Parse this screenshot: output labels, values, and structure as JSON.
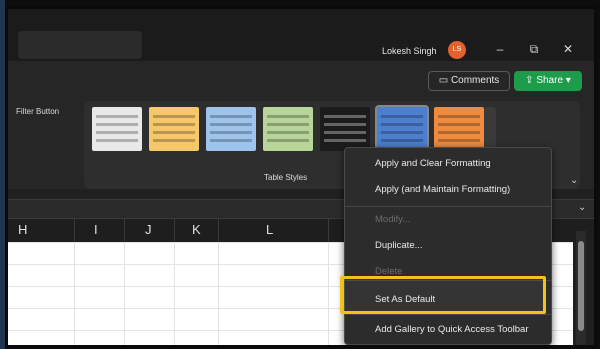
{
  "titlebar": {
    "user_name": "Lokesh Singh",
    "avatar_initials": "LS",
    "minimize": "–",
    "restore": "⧉",
    "close": "✕"
  },
  "ribbon": {
    "comments_label": "Comments",
    "share_label": "Share",
    "filter_button_label": "Filter Button",
    "table_styles_label": "Table Styles",
    "swatch_colors": [
      "#e8e8e8",
      "#f6c86a",
      "#9ec4ee",
      "#b8d69a",
      "#1c1c1c",
      "#4c7fd0",
      "#f08a3c"
    ]
  },
  "columns": [
    "H",
    "I",
    "J",
    "K",
    "L"
  ],
  "context_menu": {
    "items": [
      {
        "label": "Apply and Clear Formatting",
        "disabled": false
      },
      {
        "label": "Apply (and Maintain Formatting)",
        "disabled": false
      },
      {
        "label": "Modify...",
        "disabled": true
      },
      {
        "label": "Duplicate...",
        "disabled": false
      },
      {
        "label": "Delete",
        "disabled": true
      },
      {
        "label": "Set As Default",
        "disabled": false
      },
      {
        "label": "Add Gallery to Quick Access Toolbar",
        "disabled": false
      }
    ],
    "highlight_color": "#f2c21b"
  }
}
